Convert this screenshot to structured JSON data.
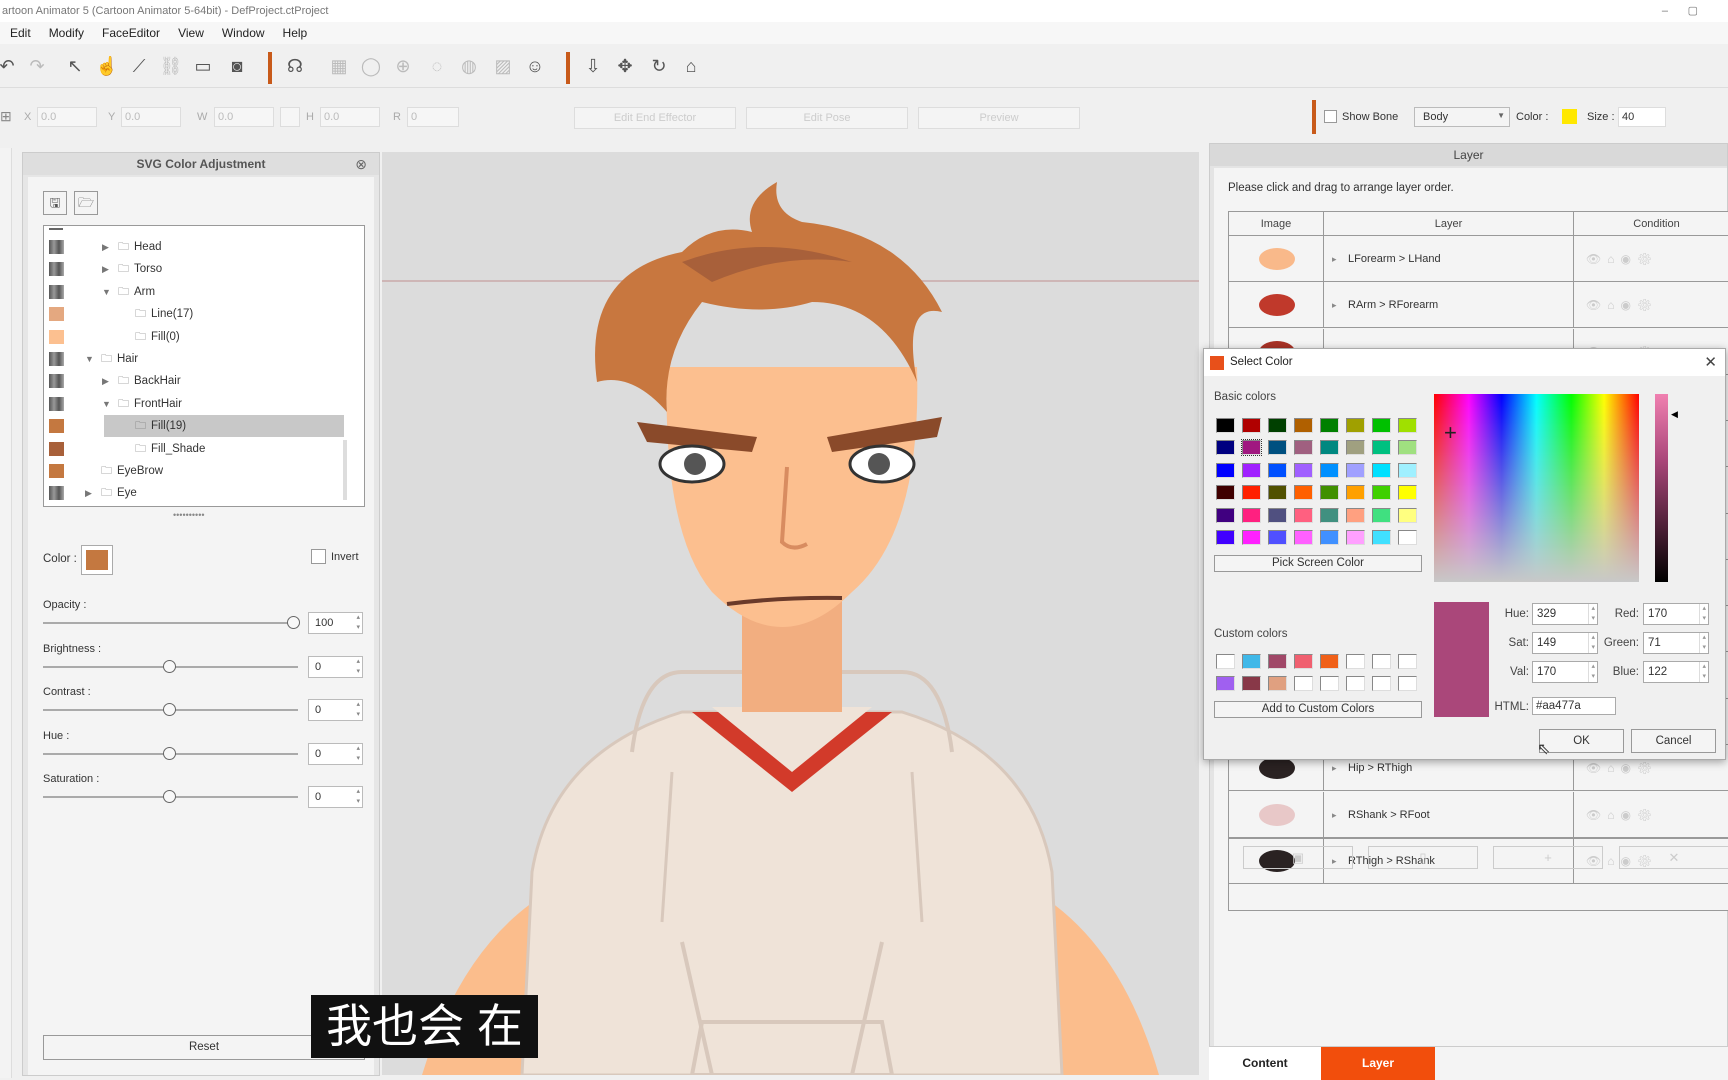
{
  "window": {
    "title": "artoon Animator 5  (Cartoon Animator 5-64bit) - DefProject.ctProject",
    "min": "–",
    "max": "▢"
  },
  "menu": [
    "Edit",
    "Modify",
    "FaceEditor",
    "View",
    "Window",
    "Help"
  ],
  "toolbar2": {
    "x_label": "X",
    "x": "0.0",
    "y_label": "Y",
    "y": "0.0",
    "w_label": "W",
    "w": "0.0",
    "h_label": "H",
    "h": "0.0",
    "r_label": "R",
    "r": "0",
    "edit_end_effector": "Edit End Effector",
    "edit_pose": "Edit Pose",
    "preview": "Preview",
    "show_bone": "Show Bone",
    "bone_select": "Body",
    "color_label": "Color :",
    "bone_color": "#ffe800",
    "size_label": "Size :",
    "size": "40"
  },
  "accent": "#f24e0c",
  "svg_panel": {
    "title": "SVG Color Adjustment",
    "tree": [
      {
        "label": "Head",
        "level": 2,
        "arrow": "right",
        "swatch": "grad"
      },
      {
        "label": "Torso",
        "level": 2,
        "arrow": "right",
        "swatch": "grad"
      },
      {
        "label": "Arm",
        "level": 2,
        "arrow": "down",
        "swatch": "grad"
      },
      {
        "label": "Line(17)",
        "level": 3,
        "arrow": "",
        "swatch": "#e4a880"
      },
      {
        "label": "Fill(0)",
        "level": 3,
        "arrow": "",
        "swatch": "#fcc090"
      },
      {
        "label": "Hair",
        "level": 1,
        "arrow": "down",
        "swatch": "grad"
      },
      {
        "label": "BackHair",
        "level": 2,
        "arrow": "right",
        "swatch": "grad"
      },
      {
        "label": "FrontHair",
        "level": 2,
        "arrow": "down",
        "swatch": "grad"
      },
      {
        "label": "Fill(19)",
        "level": 3,
        "arrow": "",
        "swatch": "#c47840",
        "selected": true
      },
      {
        "label": "Fill_Shade",
        "level": 3,
        "arrow": "",
        "swatch": "#a8603a"
      },
      {
        "label": "EyeBrow",
        "level": 1,
        "arrow": "",
        "swatch": "#c47840"
      },
      {
        "label": "Eye",
        "level": 1,
        "arrow": "right",
        "swatch": "grad"
      }
    ],
    "color_label": "Color :",
    "color": "#c47840",
    "invert_label": "Invert",
    "sliders": [
      {
        "label": "Opacity :",
        "value": "100",
        "fraction": 1.0
      },
      {
        "label": "Brightness :",
        "value": "0",
        "fraction": 0.5
      },
      {
        "label": "Contrast :",
        "value": "0",
        "fraction": 0.5
      },
      {
        "label": "Hue :",
        "value": "0",
        "fraction": 0.5
      },
      {
        "label": "Saturation :",
        "value": "0",
        "fraction": 0.5
      }
    ],
    "reset": "Reset"
  },
  "layer_panel": {
    "title": "Layer",
    "hint": "Please click and drag to arrange layer order.",
    "columns": [
      "Image",
      "Layer",
      "Condition"
    ],
    "rows_top": [
      "LForearm > LHand",
      "RArm > RForearm"
    ],
    "rows_bottom": [
      "Hip > RThigh",
      "RShank > RFoot",
      "RThigh > RShank"
    ],
    "tabs": [
      "Content",
      "Layer"
    ]
  },
  "dialog": {
    "title": "Select Color",
    "basic_label": "Basic colors",
    "basic_colors": [
      [
        "#000000",
        "#b00000",
        "#004000",
        "#b06000",
        "#008000",
        "#a0a000",
        "#00c000",
        "#a0e000"
      ],
      [
        "#000080",
        "#a01880",
        "#005080",
        "#a06080",
        "#008880",
        "#a0a080",
        "#00c080",
        "#a0e080"
      ],
      [
        "#0000ff",
        "#a020ff",
        "#0050ff",
        "#a060ff",
        "#0090ff",
        "#a0a0ff",
        "#00e0ff",
        "#a0f0ff"
      ],
      [
        "#400000",
        "#ff2000",
        "#505000",
        "#ff6000",
        "#409000",
        "#ffa000",
        "#40d000",
        "#ffff00"
      ],
      [
        "#400080",
        "#ff2080",
        "#505080",
        "#ff6080",
        "#409080",
        "#ffa080",
        "#40e080",
        "#ffff80"
      ],
      [
        "#4000ff",
        "#ff20ff",
        "#5050ff",
        "#ff60ff",
        "#4090ff",
        "#ffa0ff",
        "#40e0ff",
        "#ffffff"
      ]
    ],
    "selected_basic": [
      1,
      1
    ],
    "pick_screen": "Pick Screen Color",
    "custom_label": "Custom colors",
    "custom_colors": [
      [
        "#ffffff",
        "#40b8e8",
        "#a04868",
        "#f06070",
        "#f06018",
        "#ffffff",
        "#ffffff",
        "#ffffff"
      ],
      [
        "#a060f0",
        "#883848",
        "#e0a080",
        "#ffffff",
        "#ffffff",
        "#ffffff",
        "#ffffff",
        "#ffffff"
      ]
    ],
    "add_custom": "Add to Custom Colors",
    "hue_label": "Hue:",
    "hue": "329",
    "sat_label": "Sat:",
    "sat": "149",
    "val_label": "Val:",
    "val": "170",
    "red_label": "Red:",
    "red": "170",
    "green_label": "Green:",
    "green": "71",
    "blue_label": "Blue:",
    "blue": "122",
    "html_label": "HTML:",
    "html": "#aa477a",
    "current": "#aa477a",
    "ok": "OK",
    "cancel": "Cancel"
  },
  "subtitle": "我也会 在"
}
